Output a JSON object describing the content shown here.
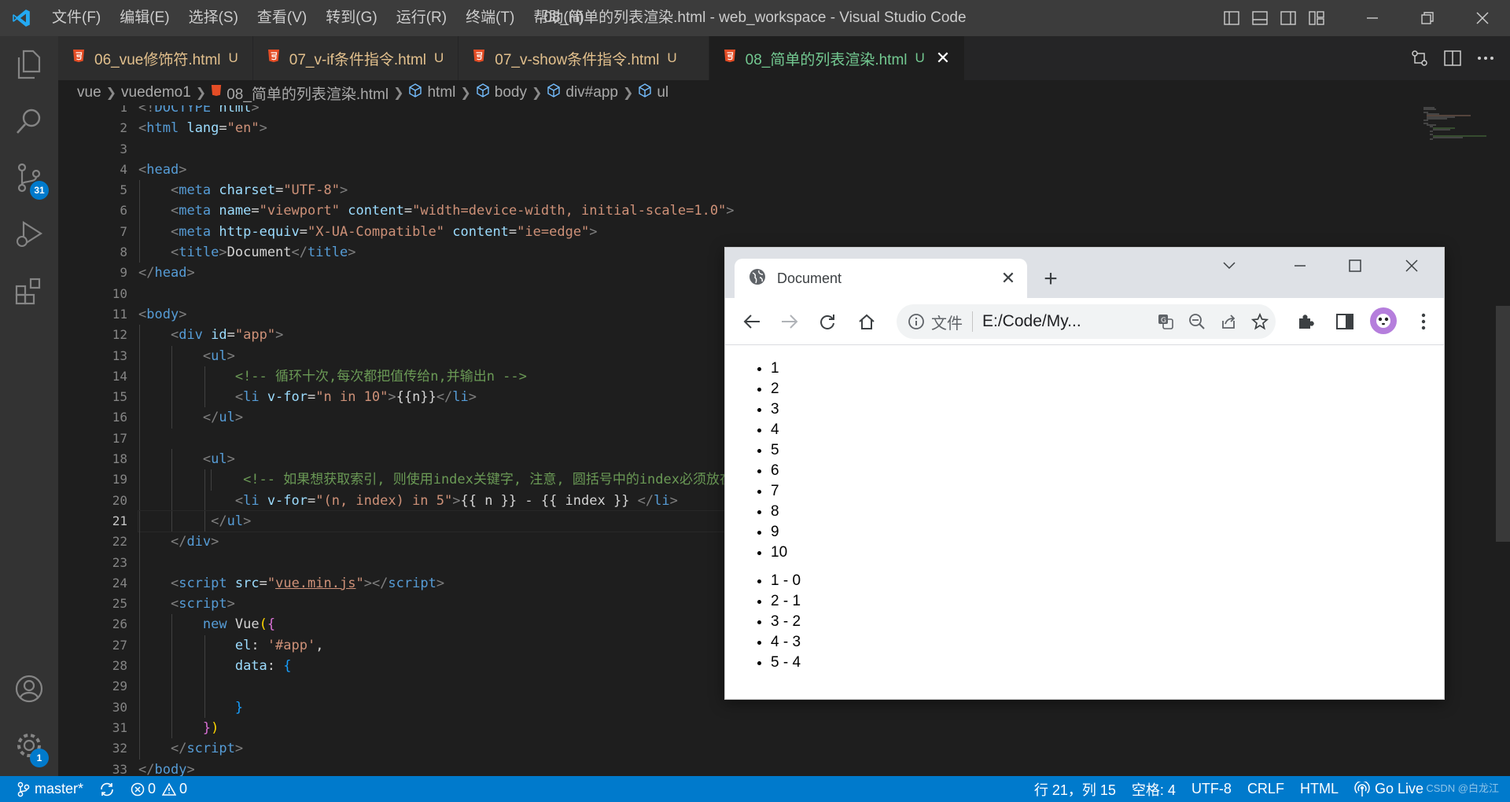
{
  "titlebar": {
    "menu": [
      "文件(F)",
      "编辑(E)",
      "选择(S)",
      "查看(V)",
      "转到(G)",
      "运行(R)",
      "终端(T)",
      "帮助(H)"
    ],
    "window_title": "08_简单的列表渲染.html - web_workspace - Visual Studio Code"
  },
  "activitybar": {
    "items": [
      "explorer-icon",
      "search-icon",
      "source-control-icon",
      "run-debug-icon",
      "extensions-icon"
    ],
    "scm_badge": "31",
    "settings_badge": "1"
  },
  "tabs": [
    {
      "label": "06_vue修饰符.html",
      "status": "U"
    },
    {
      "label": "07_v-if条件指令.html",
      "status": "U"
    },
    {
      "label": "07_v-show条件指令.html",
      "status": "U"
    },
    {
      "label": "08_简单的列表渲染.html",
      "status": "U",
      "active": true
    }
  ],
  "breadcrumb": [
    "vue",
    "vuedemo1",
    "08_简单的列表渲染.html",
    "html",
    "body",
    "div#app",
    "ul"
  ],
  "editor": {
    "line_numbers": [
      "1",
      "2",
      "3",
      "4",
      "5",
      "6",
      "7",
      "8",
      "9",
      "10",
      "11",
      "12",
      "13",
      "14",
      "15",
      "16",
      "17",
      "18",
      "19",
      "20",
      "21",
      "22",
      "23",
      "24",
      "25",
      "26",
      "27",
      "28",
      "29",
      "30",
      "31",
      "32",
      "33"
    ],
    "current_line": 21
  },
  "statusbar": {
    "branch": "master*",
    "errors": "0",
    "warnings": "0",
    "position": "行 21，列 15",
    "indent": "空格: 4",
    "encoding": "UTF-8",
    "eol": "CRLF",
    "language": "HTML",
    "golive": "Go Live"
  },
  "watermark": "CSDN @白龙江",
  "browser": {
    "tab_title": "Document",
    "omnibox_label": "文件",
    "url": "E:/Code/My...",
    "list1": [
      "1",
      "2",
      "3",
      "4",
      "5",
      "6",
      "7",
      "8",
      "9",
      "10"
    ],
    "list2": [
      "1 - 0",
      "2 - 1",
      "3 - 2",
      "4 - 3",
      "5 - 4"
    ]
  },
  "colors": {
    "statusbar": "#007acc",
    "activitybar": "#333333",
    "titlebar": "#3c3c3c",
    "editor_bg": "#1e1e1e",
    "untracked": "#73c991",
    "modified": "#e2c08d"
  }
}
